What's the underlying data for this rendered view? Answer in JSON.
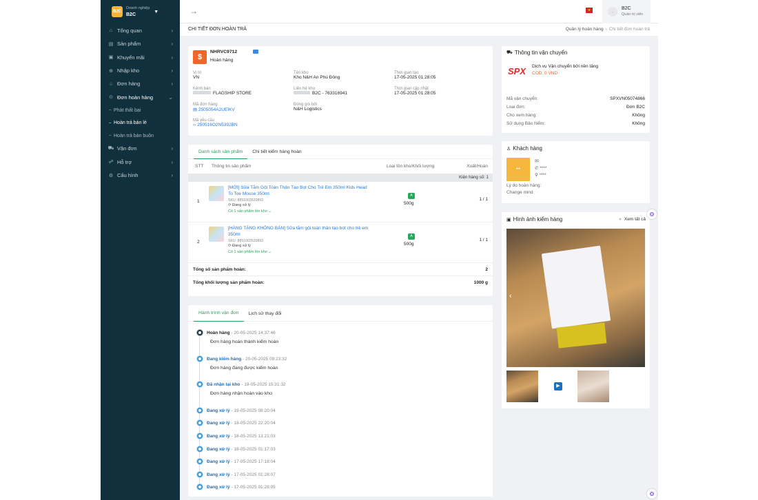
{
  "sidebar": {
    "brand_line1": "Doanh nghiệp",
    "brand_line2": "B2C",
    "logo_text": "B2C",
    "items": [
      {
        "label": "Tổng quan",
        "icon": "dashboard-icon"
      },
      {
        "label": "Sản phẩm",
        "icon": "product-icon"
      },
      {
        "label": "Khuyến mãi",
        "icon": "promotion-icon"
      },
      {
        "label": "Nhập kho",
        "icon": "warehouse-icon"
      },
      {
        "label": "Đơn hàng",
        "icon": "order-icon"
      },
      {
        "label": "Đơn hoàn hàng",
        "icon": "return-icon"
      }
    ],
    "subitems": [
      "Phát thất bại",
      "Hoàn trả bán lẻ",
      "Hoàn trả bán buôn"
    ],
    "items_after": [
      {
        "label": "Vận đơn",
        "icon": "truck-icon"
      },
      {
        "label": "Hỗ trợ",
        "icon": "support-icon"
      },
      {
        "label": "Cấu hình",
        "icon": "settings-icon"
      }
    ]
  },
  "topbar": {
    "user_name": "B2C",
    "user_role": "Quản trị viên"
  },
  "page": {
    "title": "CHI TIẾT ĐƠN HOÀN TRẢ",
    "breadcrumb": [
      "Quản lý hoàn hàng",
      "Chi tiết đơn hoàn trả"
    ]
  },
  "order": {
    "code": "NHRVC9712",
    "status": "Hoàn hàng",
    "fields": [
      {
        "label": "Vị trí",
        "value": "VN"
      },
      {
        "label": "Tên kho",
        "value": "Kho N&H An Phú Đông"
      },
      {
        "label": "Thời gian tạo",
        "value": "17-05-2025 01:28:05"
      },
      {
        "label": "Kênh bán",
        "value": "FLAGSHIP STORE"
      },
      {
        "label": "Liên hệ kho",
        "value": "B2C - 763316941"
      },
      {
        "label": "Thời gian cập nhật",
        "value": "17-05-2025 01:28:05"
      },
      {
        "label": "Mã đơn hàng",
        "value": "2505054A2UEIKV"
      },
      {
        "label": "Đóng gói bởi",
        "value": "N&H Logistics"
      },
      {
        "label": "Mã yêu cầu",
        "value": "250516O2N5392BN"
      }
    ]
  },
  "products": {
    "tabs": [
      "Danh sách sản phẩm",
      "Chi tiết kiểm hàng hoàn"
    ],
    "headers": [
      "STT",
      "Thông tin sản phẩm",
      "Loại tồn kho/Khối lượng",
      "Xuất/Hoàn"
    ],
    "package_label": "Kiện hàng số: 1",
    "rows": [
      {
        "stt": "1",
        "name": "[MỚI] Sữa Tắm Gội Toàn Thân Tạo Bọt Cho Trẻ Em 350ml Kids Head To Toe Mouse 350ml",
        "sku": "SKU: 8851003520893",
        "status": "Đang xử lý",
        "extra": "Có 1 sản phẩm tồn kho",
        "grade": "A",
        "weight": "500g",
        "qty": "1 / 1"
      },
      {
        "stt": "2",
        "name": "[HÀNG TẶNG KHÔNG BÁN] Sữa tắm gội toàn thân tạo bọt cho trẻ em 350ml",
        "sku": "SKU: 8851003520893",
        "status": "Đang xử lý",
        "extra": "Có 1 sản phẩm tồn kho",
        "grade": "A",
        "weight": "500g",
        "qty": "1 / 1"
      }
    ],
    "total_label": "Tổng số sản phẩm hoàn:",
    "total_value": "2",
    "weight_label": "Tổng khối lượng sản phẩm hoàn:",
    "weight_value": "1000 g"
  },
  "journey": {
    "tabs": [
      "Hành trình vận đơn",
      "Lịch sử thay đổi"
    ],
    "events": [
      {
        "status": "Hoàn hàng",
        "time": "20-05-2025 14:37:46",
        "note": "Đơn hàng hoàn thành kiểm hoàn"
      },
      {
        "status": "Đang kiểm hàng",
        "time": "20-05-2025 09:23:32",
        "note": "Đơn hàng đang được kiểm hoàn"
      },
      {
        "status": "Đã nhận tại kho",
        "time": "19-05-2025 15:31:32",
        "note": "Đơn hàng nhận hoàn vào kho"
      },
      {
        "status": "Đang xử lý",
        "time": "19-05-2025 08:20:04",
        "note": ""
      },
      {
        "status": "Đang xử lý",
        "time": "18-05-2025 22:20:04",
        "note": ""
      },
      {
        "status": "Đang xử lý",
        "time": "18-05-2025 13:21:03",
        "note": ""
      },
      {
        "status": "Đang xử lý",
        "time": "18-05-2025 01:17:03",
        "note": ""
      },
      {
        "status": "Đang xử lý",
        "time": "17-05-2025 17:18:04",
        "note": ""
      },
      {
        "status": "Đang xử lý",
        "time": "17-05-2025 01:28:07",
        "note": ""
      },
      {
        "status": "Đang xử lý",
        "time": "17-05-2025 01:28:05",
        "note": ""
      }
    ]
  },
  "shipping": {
    "title": "Thông tin vận chuyển",
    "carrier_logo": "SPX",
    "carrier": "Dịch vụ Vận chuyển bởi nền tảng",
    "cod": "COD: 0 VND",
    "rows": [
      {
        "k": "Mã vận chuyển:",
        "v": "SPXVN05074866"
      },
      {
        "k": "Loại đơn:",
        "v": "Đơn B2C"
      },
      {
        "k": "Cho xem hàng:",
        "v": "Không"
      },
      {
        "k": "Sử dụng Bảo hiểm:",
        "v": "Không"
      }
    ]
  },
  "customer": {
    "title": "Khách hàng",
    "avatar": "**",
    "phone": "****",
    "address": "****",
    "reason_label": "Lý do hoàn hàng:",
    "reason": "Change mind"
  },
  "images": {
    "title": "Hình ảnh kiểm hàng",
    "view_all": "Xem tất cả"
  },
  "colors": {
    "sidebar": "#10303e",
    "accent": "#22a35a",
    "link": "#2a7bd8",
    "shop": "#f0662a"
  }
}
